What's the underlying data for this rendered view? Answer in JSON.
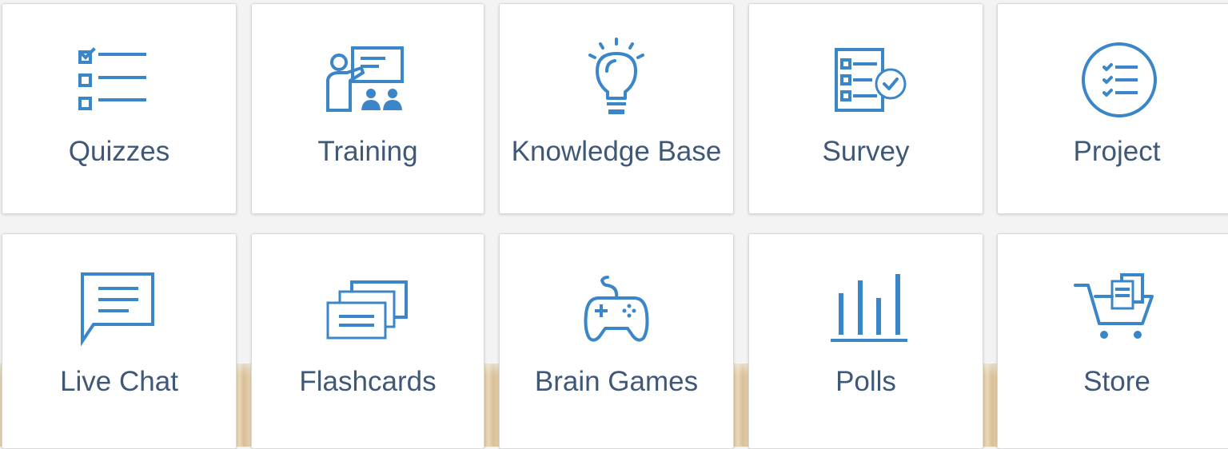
{
  "tiles": [
    {
      "label": "Quizzes",
      "icon": "checklist-icon"
    },
    {
      "label": "Training",
      "icon": "presentation-icon"
    },
    {
      "label": "Knowledge Base",
      "icon": "lightbulb-icon"
    },
    {
      "label": "Survey",
      "icon": "survey-form-icon"
    },
    {
      "label": "Project",
      "icon": "project-list-icon"
    },
    {
      "label": "Live Chat",
      "icon": "chat-bubble-icon"
    },
    {
      "label": "Flashcards",
      "icon": "flashcards-icon"
    },
    {
      "label": "Brain Games",
      "icon": "gamepad-icon"
    },
    {
      "label": "Polls",
      "icon": "bar-chart-icon"
    },
    {
      "label": "Store",
      "icon": "shopping-cart-icon"
    }
  ],
  "colors": {
    "icon": "#3a86c8",
    "label": "#3f5878",
    "tile_background": "#ffffff",
    "page_background": "#f3f3f3"
  }
}
